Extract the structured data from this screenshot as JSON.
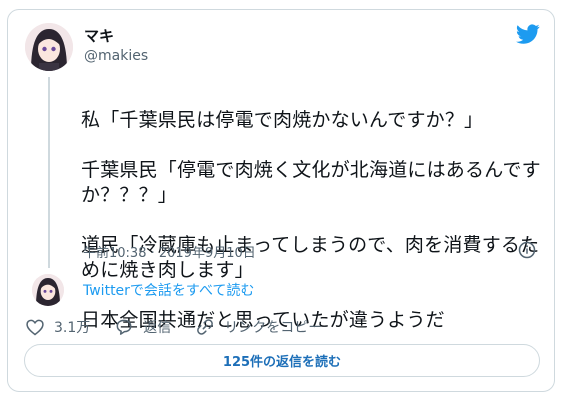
{
  "author": {
    "name": "マキ",
    "handle": "@makies"
  },
  "tweet": {
    "lines": [
      "私「千葉県民は停電で肉焼かないんですか？」",
      "千葉県民「停電で肉焼く文化が北海道にはあるんですか？？？」",
      "道民「冷蔵庫も止まってしまうので、肉を消費するために焼き肉します」",
      "日本全国共通だと思っていたが違うようだ"
    ],
    "timestamp": "午前10:38 · 2019年9月10日"
  },
  "thread_link": "Twitterで会話をすべて読む",
  "actions": {
    "like_count": "3.1万",
    "reply_label": "返信",
    "copy_link_label": "リンクをコピー"
  },
  "read_replies_label": "125件の返信を読む",
  "colors": {
    "accent": "#1d9bf0",
    "text": "#0f1419",
    "secondary": "#536471",
    "border": "#cfd9de"
  },
  "icons": [
    "twitter-bird-icon",
    "info-icon",
    "heart-icon",
    "reply-icon",
    "link-icon"
  ]
}
